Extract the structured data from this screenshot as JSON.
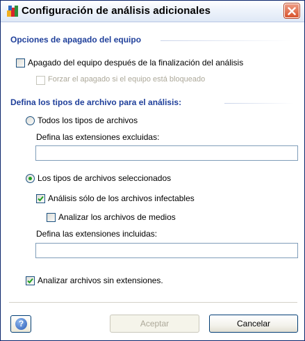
{
  "window": {
    "title": "Configuración de análisis adicionales",
    "icon": "avg-app-icon",
    "close_icon": "close-icon"
  },
  "shutdown": {
    "heading": "Opciones de apagado del equipo",
    "shutdown_after": {
      "label": "Apagado del equipo después de la finalización del análisis",
      "checked": false
    },
    "force_shutdown": {
      "label": "Forzar el apagado si el equipo está bloqueado",
      "checked": false,
      "disabled": true
    }
  },
  "filetypes": {
    "heading": "Defina los tipos de archivo para el análisis:",
    "all_types": {
      "label": "Todos los tipos de archivos",
      "selected": false
    },
    "excluded": {
      "label": "Defina las extensiones excluidas:",
      "value": ""
    },
    "selected_types": {
      "label": "Los tipos de archivos seleccionados",
      "selected": true
    },
    "infectable_only": {
      "label": "Análisis sólo de los archivos infectables",
      "checked": true
    },
    "media_files": {
      "label": "Analizar los archivos de medios",
      "checked": false
    },
    "included": {
      "label": "Defina las extensiones incluidas:",
      "value": ""
    },
    "no_extension": {
      "label": "Analizar archivos sin extensiones.",
      "checked": true
    }
  },
  "footer": {
    "help_icon": "help-icon",
    "help_glyph": "?",
    "accept_label": "Aceptar",
    "accept_disabled": true,
    "cancel_label": "Cancelar"
  },
  "colors": {
    "heading": "#1f3f9a",
    "check": "#21a121",
    "disabled_text": "#aca899",
    "close_button": "#d8532c"
  }
}
